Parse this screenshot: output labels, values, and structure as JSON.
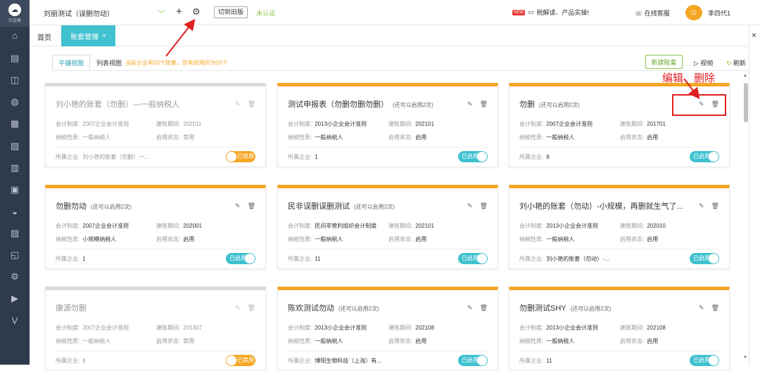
{
  "app": {
    "logo_text": "亿企账"
  },
  "sidebar": {
    "icons": [
      "home-icon",
      "ledger-icon",
      "chart-icon",
      "money-bag-icon",
      "document-icon",
      "invoice-icon",
      "archive-icon",
      "card-icon",
      "stamp-icon",
      "report-icon",
      "inbox-icon",
      "settings-icon",
      "video-icon",
      "v-icon"
    ],
    "glyphs": [
      "⌂",
      "▤",
      "◫",
      "◍",
      "▦",
      "▧",
      "▥",
      "▣",
      "◒",
      "▨",
      "◱",
      "⚙",
      "▶",
      "V"
    ]
  },
  "topbar": {
    "company": "刘丽测试（误删勿动）",
    "plus": "+",
    "gear": "⚙",
    "old_version": "切到旧版",
    "unverified": "未认证",
    "news_badge": "NEW",
    "news": "税解读、产品实操!",
    "service": "在线客服",
    "avatar_glyph": "☺",
    "user": "李四代1"
  },
  "tabs": {
    "home": "首页",
    "active": "账套管理",
    "active_close": "×"
  },
  "gutter_close": "×",
  "toolbar": {
    "view_tabs": [
      "平铺视图",
      "列表视图"
    ],
    "notice": "当前企业有53个账套，您有权限的为55个",
    "new_button": "新建账套",
    "video": "视频",
    "refresh": "刷新"
  },
  "labels": {
    "system": "会计制度:",
    "period": "建账期间:",
    "taxpayer": "纳税性质:",
    "status": "启用状态:",
    "owner": "所属企业:"
  },
  "cards": [
    {
      "title": "刘小艳的账套（勿删）—一般纳税人",
      "remain": "",
      "system": "2007企业会计准则",
      "period": "202011",
      "taxpayer": "一般纳税人",
      "status": "禁用",
      "owner": "刘小艳的账套（勿删）一...",
      "toggle": "已禁用",
      "enabled": false
    },
    {
      "title": "测试申报表（勿删勿删勿删）",
      "remain": "(还可以启用2次)",
      "system": "2013小企业会计准则",
      "period": "202101",
      "taxpayer": "一般纳税人",
      "status": "启用",
      "owner": "1",
      "toggle": "已启用",
      "enabled": true
    },
    {
      "title": "勿删",
      "remain": "(还可以启用2次)",
      "system": "2007企业会计准则",
      "period": "201701",
      "taxpayer": "一般纳税人",
      "status": "启用",
      "owner": "8",
      "toggle": "已启用",
      "enabled": true
    },
    {
      "title": "勿删勿动",
      "remain": "(还可以启用2次)",
      "system": "2007企业会计准则",
      "period": "202001",
      "taxpayer": "小规模纳税人",
      "status": "启用",
      "owner": "1",
      "toggle": "已启用",
      "enabled": true
    },
    {
      "title": "民非误删误删测试",
      "remain": "(还可以启用2次)",
      "system": "民间非营利组织会计制度",
      "period": "202101",
      "taxpayer": "一般纳税人",
      "status": "启用",
      "owner": "11",
      "toggle": "已启用",
      "enabled": true
    },
    {
      "title": "刘小艳的账套（勿动）-小规模，再删就生气了...",
      "remain": "",
      "system": "2013小企业会计准则",
      "period": "202010",
      "taxpayer": "一般纳税人",
      "status": "启用",
      "owner": "刘小艳的账套（勿动）-...",
      "toggle": "已启用",
      "enabled": true
    },
    {
      "title": "康源勿删",
      "remain": "",
      "system": "2007企业会计准则",
      "period": "201307",
      "taxpayer": "一般纳税人",
      "status": "禁用",
      "owner": "8",
      "toggle": "已禁用",
      "enabled": false
    },
    {
      "title": "陈欢测试勿动",
      "remain": "(还可以启用2次)",
      "system": "2013小企业会计准则",
      "period": "202108",
      "taxpayer": "一般纳税人",
      "status": "启用",
      "owner": "博阳生物科技（上海）有...",
      "toggle": "已启用",
      "enabled": true
    },
    {
      "title": "勿删测试SHY",
      "remain": "(还可以启用2次)",
      "system": "2013小企业会计准则",
      "period": "202108",
      "taxpayer": "一般纳税人",
      "status": "启用",
      "owner": "11",
      "toggle": "已启用",
      "enabled": true
    }
  ],
  "annotation": {
    "text": "编辑、删除",
    "color": "#e02020"
  },
  "colors": {
    "accent": "#3fc1cf",
    "orange": "#f5a623",
    "sidebar": "#2f3a4c",
    "green": "#8bc34a"
  }
}
